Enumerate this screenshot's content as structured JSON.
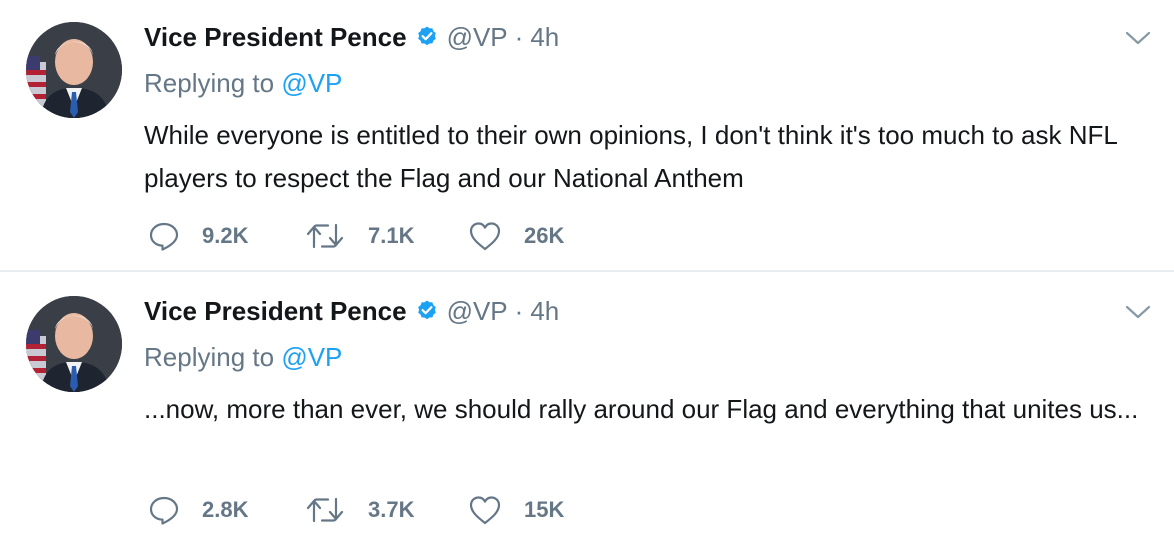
{
  "colors": {
    "accent": "#1da1f2",
    "muted": "#657786",
    "text": "#14171a",
    "divider": "#e6ecf0"
  },
  "tweets": [
    {
      "author_name": "Vice President Pence",
      "handle": "@VP",
      "separator": "·",
      "time": "4h",
      "replying_prefix": "Replying to",
      "replying_to": "@VP",
      "text": "While everyone is entitled to their own opinions, I don't think it's too much to ask NFL players to respect the Flag and our National Anthem",
      "replies": "9.2K",
      "retweets": "7.1K",
      "likes": "26K"
    },
    {
      "author_name": "Vice President Pence",
      "handle": "@VP",
      "separator": "·",
      "time": "4h",
      "replying_prefix": "Replying to",
      "replying_to": "@VP",
      "text": "...now, more than ever, we should rally around our Flag and everything that unites us...",
      "replies": "2.8K",
      "retweets": "3.7K",
      "likes": "15K"
    }
  ]
}
